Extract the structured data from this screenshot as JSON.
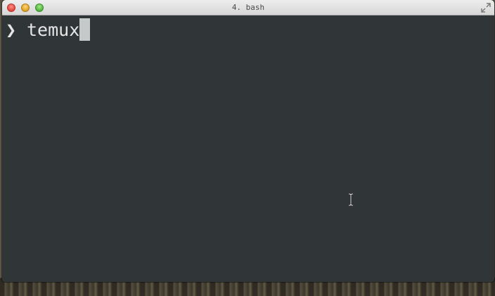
{
  "window": {
    "title": "4. bash",
    "controls": {
      "close": "close-button",
      "minimize": "minimize-button",
      "zoom": "zoom-button",
      "fullscreen_icon": "fullscreen-arrows-icon"
    }
  },
  "terminal": {
    "prompt_symbol": "❯",
    "command": "temux",
    "cursor": "block-cursor",
    "background": "#303538",
    "text_color": "#e6e6e6"
  },
  "pointer": {
    "icon": "text-ibeam-icon"
  }
}
